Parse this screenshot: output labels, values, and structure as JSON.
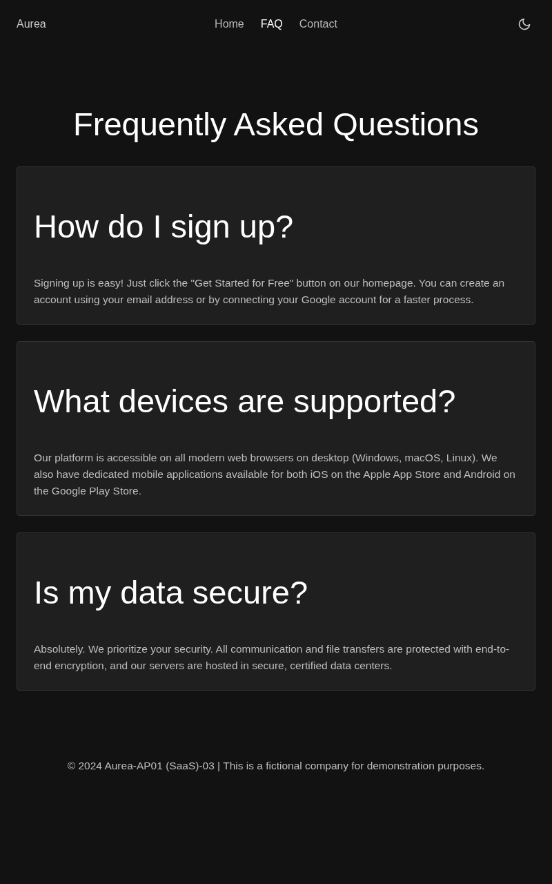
{
  "header": {
    "logo": "Aurea",
    "nav": [
      {
        "label": "Home",
        "selected": false
      },
      {
        "label": "FAQ",
        "selected": true
      },
      {
        "label": "Contact",
        "selected": false
      }
    ]
  },
  "page_title": "Frequently Asked Questions",
  "faqs": [
    {
      "question": "How do I sign up?",
      "answer": "Signing up is easy! Just click the \"Get Started for Free\" button on our homepage. You can create an account using your email address or by connecting your Google account for a faster process."
    },
    {
      "question": "What devices are supported?",
      "answer": "Our platform is accessible on all modern web browsers on desktop (Windows, macOS, Linux). We also have dedicated mobile applications available for both iOS on the Apple App Store and Android on the Google Play Store."
    },
    {
      "question": "Is my data secure?",
      "answer": "Absolutely. We prioritize your security. All communication and file transfers are protected with end-to-end encryption, and our servers are hosted in secure, certified data centers."
    }
  ],
  "footer": {
    "text": "© 2024 Aurea-AP01 (SaaS)-03 | This is a fictional company for demonstration purposes."
  }
}
